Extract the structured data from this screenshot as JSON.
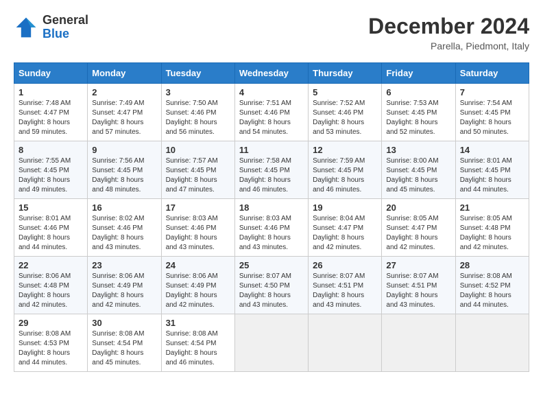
{
  "header": {
    "logo_general": "General",
    "logo_blue": "Blue",
    "month_year": "December 2024",
    "location": "Parella, Piedmont, Italy"
  },
  "days_of_week": [
    "Sunday",
    "Monday",
    "Tuesday",
    "Wednesday",
    "Thursday",
    "Friday",
    "Saturday"
  ],
  "weeks": [
    [
      {
        "day": "1",
        "sunrise": "Sunrise: 7:48 AM",
        "sunset": "Sunset: 4:47 PM",
        "daylight": "Daylight: 8 hours and 59 minutes."
      },
      {
        "day": "2",
        "sunrise": "Sunrise: 7:49 AM",
        "sunset": "Sunset: 4:47 PM",
        "daylight": "Daylight: 8 hours and 57 minutes."
      },
      {
        "day": "3",
        "sunrise": "Sunrise: 7:50 AM",
        "sunset": "Sunset: 4:46 PM",
        "daylight": "Daylight: 8 hours and 56 minutes."
      },
      {
        "day": "4",
        "sunrise": "Sunrise: 7:51 AM",
        "sunset": "Sunset: 4:46 PM",
        "daylight": "Daylight: 8 hours and 54 minutes."
      },
      {
        "day": "5",
        "sunrise": "Sunrise: 7:52 AM",
        "sunset": "Sunset: 4:46 PM",
        "daylight": "Daylight: 8 hours and 53 minutes."
      },
      {
        "day": "6",
        "sunrise": "Sunrise: 7:53 AM",
        "sunset": "Sunset: 4:45 PM",
        "daylight": "Daylight: 8 hours and 52 minutes."
      },
      {
        "day": "7",
        "sunrise": "Sunrise: 7:54 AM",
        "sunset": "Sunset: 4:45 PM",
        "daylight": "Daylight: 8 hours and 50 minutes."
      }
    ],
    [
      {
        "day": "8",
        "sunrise": "Sunrise: 7:55 AM",
        "sunset": "Sunset: 4:45 PM",
        "daylight": "Daylight: 8 hours and 49 minutes."
      },
      {
        "day": "9",
        "sunrise": "Sunrise: 7:56 AM",
        "sunset": "Sunset: 4:45 PM",
        "daylight": "Daylight: 8 hours and 48 minutes."
      },
      {
        "day": "10",
        "sunrise": "Sunrise: 7:57 AM",
        "sunset": "Sunset: 4:45 PM",
        "daylight": "Daylight: 8 hours and 47 minutes."
      },
      {
        "day": "11",
        "sunrise": "Sunrise: 7:58 AM",
        "sunset": "Sunset: 4:45 PM",
        "daylight": "Daylight: 8 hours and 46 minutes."
      },
      {
        "day": "12",
        "sunrise": "Sunrise: 7:59 AM",
        "sunset": "Sunset: 4:45 PM",
        "daylight": "Daylight: 8 hours and 46 minutes."
      },
      {
        "day": "13",
        "sunrise": "Sunrise: 8:00 AM",
        "sunset": "Sunset: 4:45 PM",
        "daylight": "Daylight: 8 hours and 45 minutes."
      },
      {
        "day": "14",
        "sunrise": "Sunrise: 8:01 AM",
        "sunset": "Sunset: 4:45 PM",
        "daylight": "Daylight: 8 hours and 44 minutes."
      }
    ],
    [
      {
        "day": "15",
        "sunrise": "Sunrise: 8:01 AM",
        "sunset": "Sunset: 4:46 PM",
        "daylight": "Daylight: 8 hours and 44 minutes."
      },
      {
        "day": "16",
        "sunrise": "Sunrise: 8:02 AM",
        "sunset": "Sunset: 4:46 PM",
        "daylight": "Daylight: 8 hours and 43 minutes."
      },
      {
        "day": "17",
        "sunrise": "Sunrise: 8:03 AM",
        "sunset": "Sunset: 4:46 PM",
        "daylight": "Daylight: 8 hours and 43 minutes."
      },
      {
        "day": "18",
        "sunrise": "Sunrise: 8:03 AM",
        "sunset": "Sunset: 4:46 PM",
        "daylight": "Daylight: 8 hours and 43 minutes."
      },
      {
        "day": "19",
        "sunrise": "Sunrise: 8:04 AM",
        "sunset": "Sunset: 4:47 PM",
        "daylight": "Daylight: 8 hours and 42 minutes."
      },
      {
        "day": "20",
        "sunrise": "Sunrise: 8:05 AM",
        "sunset": "Sunset: 4:47 PM",
        "daylight": "Daylight: 8 hours and 42 minutes."
      },
      {
        "day": "21",
        "sunrise": "Sunrise: 8:05 AM",
        "sunset": "Sunset: 4:48 PM",
        "daylight": "Daylight: 8 hours and 42 minutes."
      }
    ],
    [
      {
        "day": "22",
        "sunrise": "Sunrise: 8:06 AM",
        "sunset": "Sunset: 4:48 PM",
        "daylight": "Daylight: 8 hours and 42 minutes."
      },
      {
        "day": "23",
        "sunrise": "Sunrise: 8:06 AM",
        "sunset": "Sunset: 4:49 PM",
        "daylight": "Daylight: 8 hours and 42 minutes."
      },
      {
        "day": "24",
        "sunrise": "Sunrise: 8:06 AM",
        "sunset": "Sunset: 4:49 PM",
        "daylight": "Daylight: 8 hours and 42 minutes."
      },
      {
        "day": "25",
        "sunrise": "Sunrise: 8:07 AM",
        "sunset": "Sunset: 4:50 PM",
        "daylight": "Daylight: 8 hours and 43 minutes."
      },
      {
        "day": "26",
        "sunrise": "Sunrise: 8:07 AM",
        "sunset": "Sunset: 4:51 PM",
        "daylight": "Daylight: 8 hours and 43 minutes."
      },
      {
        "day": "27",
        "sunrise": "Sunrise: 8:07 AM",
        "sunset": "Sunset: 4:51 PM",
        "daylight": "Daylight: 8 hours and 43 minutes."
      },
      {
        "day": "28",
        "sunrise": "Sunrise: 8:08 AM",
        "sunset": "Sunset: 4:52 PM",
        "daylight": "Daylight: 8 hours and 44 minutes."
      }
    ],
    [
      {
        "day": "29",
        "sunrise": "Sunrise: 8:08 AM",
        "sunset": "Sunset: 4:53 PM",
        "daylight": "Daylight: 8 hours and 44 minutes."
      },
      {
        "day": "30",
        "sunrise": "Sunrise: 8:08 AM",
        "sunset": "Sunset: 4:54 PM",
        "daylight": "Daylight: 8 hours and 45 minutes."
      },
      {
        "day": "31",
        "sunrise": "Sunrise: 8:08 AM",
        "sunset": "Sunset: 4:54 PM",
        "daylight": "Daylight: 8 hours and 46 minutes."
      },
      null,
      null,
      null,
      null
    ]
  ]
}
